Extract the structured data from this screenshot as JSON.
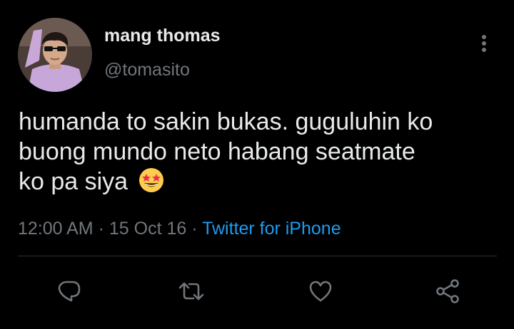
{
  "tweet": {
    "display_name": "mang thomas",
    "handle": "@tomasito",
    "text_lines": [
      "humanda to sakin bukas. guguluhin ko",
      "buong mundo neto habang seatmate",
      "ko pa siya"
    ],
    "emoji": "star-struck",
    "time": "12:00 AM",
    "separator": "·",
    "date": "15 Oct 16",
    "source": "Twitter for iPhone"
  },
  "actions": [
    {
      "icon": "reply-icon"
    },
    {
      "icon": "retweet-icon"
    },
    {
      "icon": "like-icon"
    },
    {
      "icon": "share-icon"
    }
  ],
  "colors": {
    "background": "#000000",
    "text_primary": "#e7e9ea",
    "text_secondary": "#71767b",
    "accent": "#1d9bf0",
    "divider": "#2f3336"
  }
}
